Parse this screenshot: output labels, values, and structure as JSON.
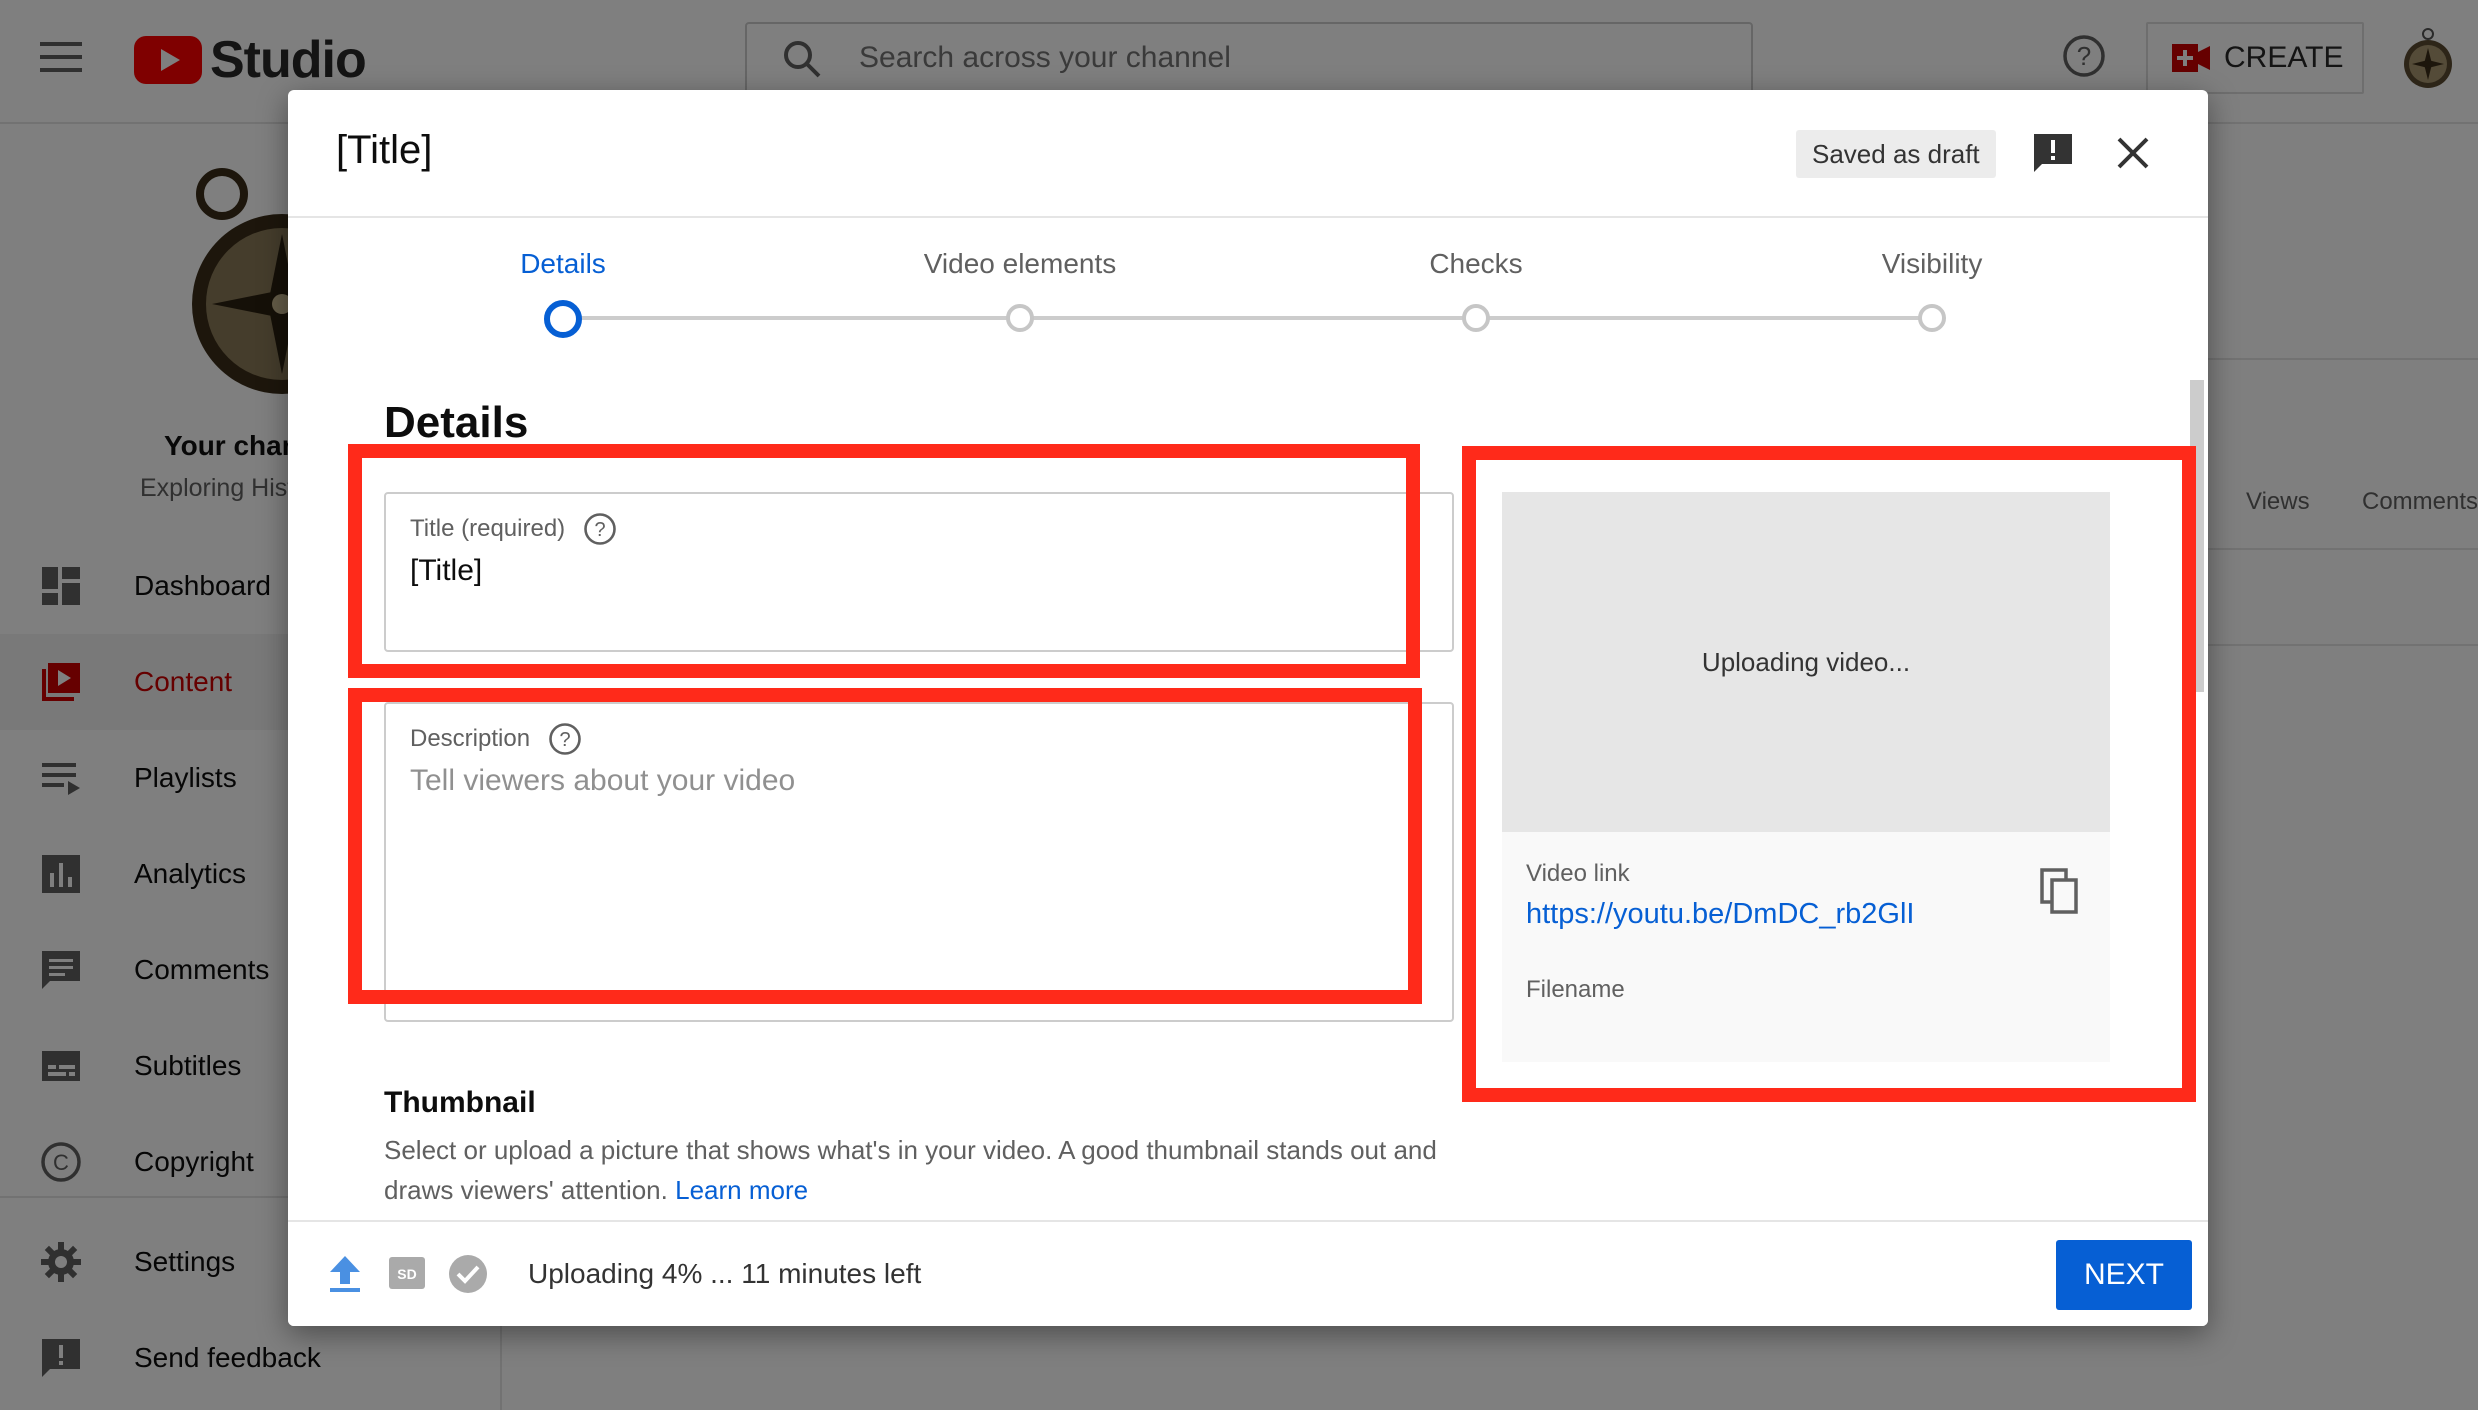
{
  "app": {
    "name": "Studio"
  },
  "search": {
    "placeholder": "Search across your channel"
  },
  "header": {
    "create_label": "CREATE"
  },
  "channel": {
    "name": "Your chan",
    "subtitle": "Exploring Hist"
  },
  "sidebar": {
    "items": [
      {
        "label": "Dashboard",
        "icon": "dashboard-icon",
        "active": false
      },
      {
        "label": "Content",
        "icon": "content-icon",
        "active": true
      },
      {
        "label": "Playlists",
        "icon": "playlists-icon",
        "active": false
      },
      {
        "label": "Analytics",
        "icon": "analytics-icon",
        "active": false
      },
      {
        "label": "Comments",
        "icon": "comments-icon",
        "active": false
      },
      {
        "label": "Subtitles",
        "icon": "subtitles-icon",
        "active": false
      },
      {
        "label": "Copyright",
        "icon": "copyright-icon",
        "active": false
      },
      {
        "label": "Settings",
        "icon": "settings-icon",
        "active": false
      },
      {
        "label": "Send feedback",
        "icon": "feedback-icon",
        "active": false
      }
    ]
  },
  "background_table": {
    "col_views": "Views",
    "col_comments": "Comments"
  },
  "dialog": {
    "title": "[Title]",
    "draft_status": "Saved as draft",
    "steps": [
      {
        "label": "Details",
        "active": true
      },
      {
        "label": "Video elements",
        "active": false
      },
      {
        "label": "Checks",
        "active": false
      },
      {
        "label": "Visibility",
        "active": false
      }
    ],
    "section_heading": "Details",
    "title_field": {
      "label": "Title (required)",
      "value": "[Title]"
    },
    "description_field": {
      "label": "Description",
      "placeholder": "Tell viewers about your video"
    },
    "preview": {
      "status": "Uploading video...",
      "video_link_label": "Video link",
      "video_link": "https://youtu.be/DmDC_rb2GlI",
      "filename_label": "Filename"
    },
    "thumbnail": {
      "heading": "Thumbnail",
      "text": "Select or upload a picture that shows what's in your video. A good thumbnail stands out and draws viewers' attention.",
      "learn_more": "Learn more"
    },
    "footer": {
      "status": "Uploading 4% ... 11 minutes left",
      "next_label": "NEXT"
    }
  },
  "colors": {
    "accent": "#065fd4",
    "brand_red": "#ff0000",
    "annotation_red": "#ff2a1a"
  }
}
